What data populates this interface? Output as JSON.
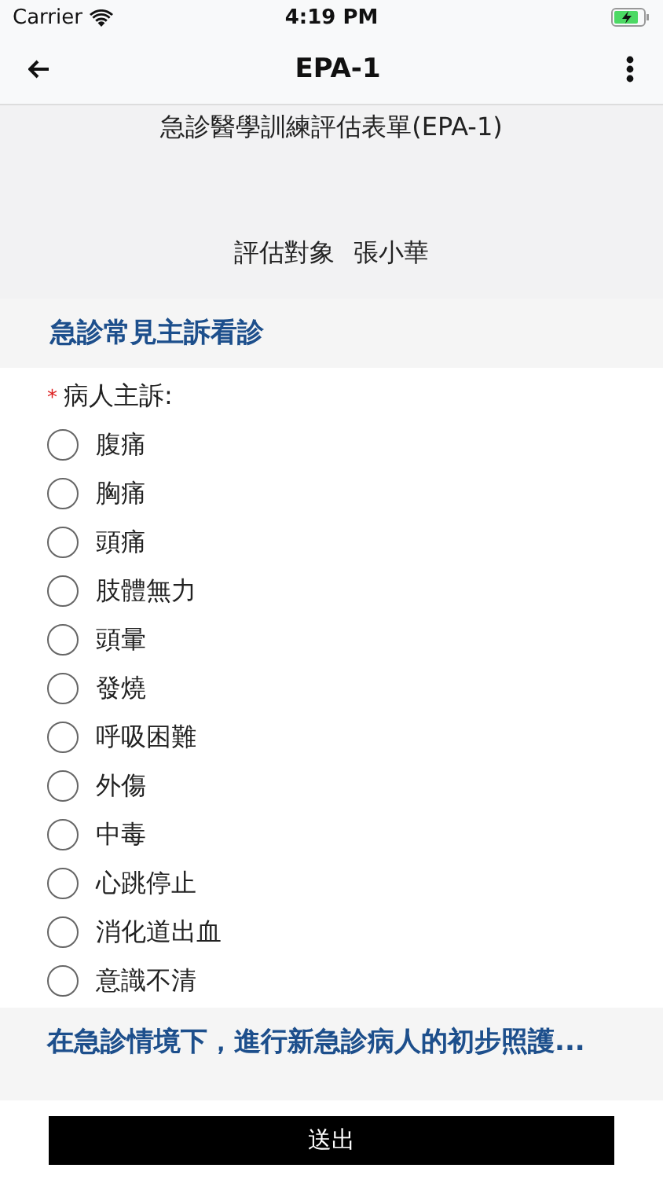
{
  "status_bar": {
    "carrier": "Carrier",
    "time": "4:19 PM"
  },
  "nav": {
    "title": "EPA-1"
  },
  "form": {
    "title": "急診醫學訓練評估表單(EPA-1)",
    "subject_label": "評估對象",
    "subject_name": "張小華"
  },
  "section": {
    "title": "急診常見主訴看診"
  },
  "question": {
    "label": "病人主訴:",
    "required_mark": "*",
    "options": [
      {
        "label": "腹痛",
        "selected": false
      },
      {
        "label": "胸痛",
        "selected": false
      },
      {
        "label": "頭痛",
        "selected": false
      },
      {
        "label": "肢體無力",
        "selected": false
      },
      {
        "label": "頭暈",
        "selected": false
      },
      {
        "label": "發燒",
        "selected": false
      },
      {
        "label": "呼吸困難",
        "selected": false
      },
      {
        "label": "外傷",
        "selected": false
      },
      {
        "label": "中毒",
        "selected": false
      },
      {
        "label": "心跳停止",
        "selected": false
      },
      {
        "label": "消化道出血",
        "selected": false
      },
      {
        "label": "意識不清",
        "selected": false
      }
    ]
  },
  "next_section": {
    "title": "在急診情境下，進行新急診病人的初步照護..."
  },
  "submit_button": "送出"
}
